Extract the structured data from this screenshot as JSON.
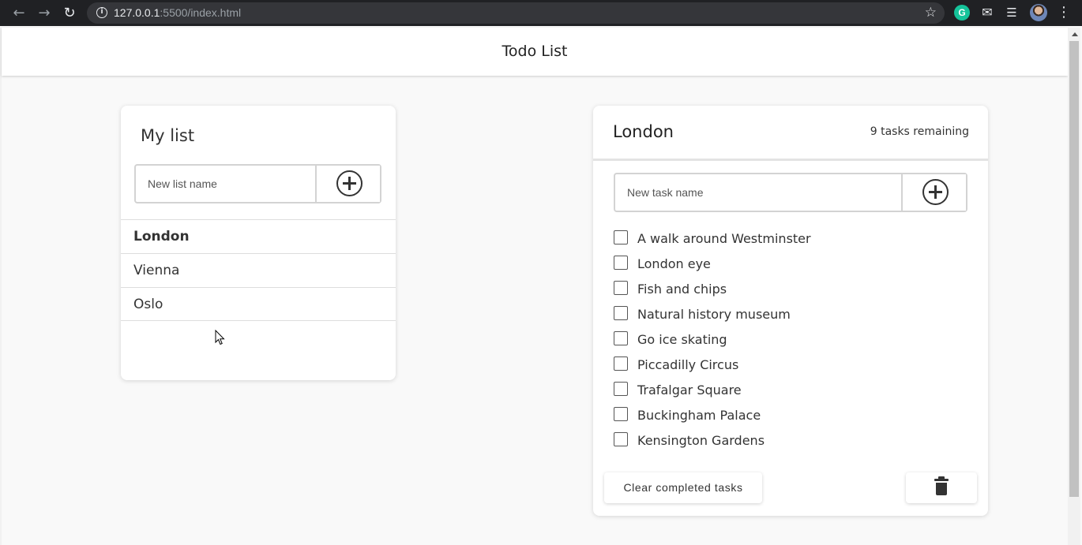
{
  "browser": {
    "url_host": "127.0.0.1",
    "url_rest": ":5500/index.html",
    "icons": [
      "back-arrow-icon",
      "forward-arrow-icon",
      "reload-icon",
      "info-icon",
      "star-icon",
      "grammarly-icon",
      "extensions-icon",
      "media-list-icon",
      "profile-avatar",
      "menu-icon"
    ]
  },
  "header": {
    "title": "Todo List"
  },
  "lists_panel": {
    "title": "My list",
    "new_list_placeholder": "New list name",
    "items": [
      {
        "label": "London",
        "active": true
      },
      {
        "label": "Vienna",
        "active": false
      },
      {
        "label": "Oslo",
        "active": false
      }
    ]
  },
  "tasks_panel": {
    "list_name": "London",
    "remaining": "9 tasks remaining",
    "new_task_placeholder": "New task name",
    "tasks": [
      {
        "label": "A walk around Westminster",
        "done": false
      },
      {
        "label": "London eye",
        "done": false
      },
      {
        "label": "Fish and chips",
        "done": false
      },
      {
        "label": "Natural history museum",
        "done": false
      },
      {
        "label": "Go ice skating",
        "done": false
      },
      {
        "label": "Piccadilly Circus",
        "done": false
      },
      {
        "label": "Trafalgar Square",
        "done": false
      },
      {
        "label": "Buckingham Palace",
        "done": false
      },
      {
        "label": "Kensington Gardens",
        "done": false
      }
    ],
    "clear_label": "Clear completed tasks"
  },
  "colors": {
    "background": "#f9f9f9",
    "card": "#ffffff",
    "text": "#333333",
    "chrome": "#202124"
  }
}
